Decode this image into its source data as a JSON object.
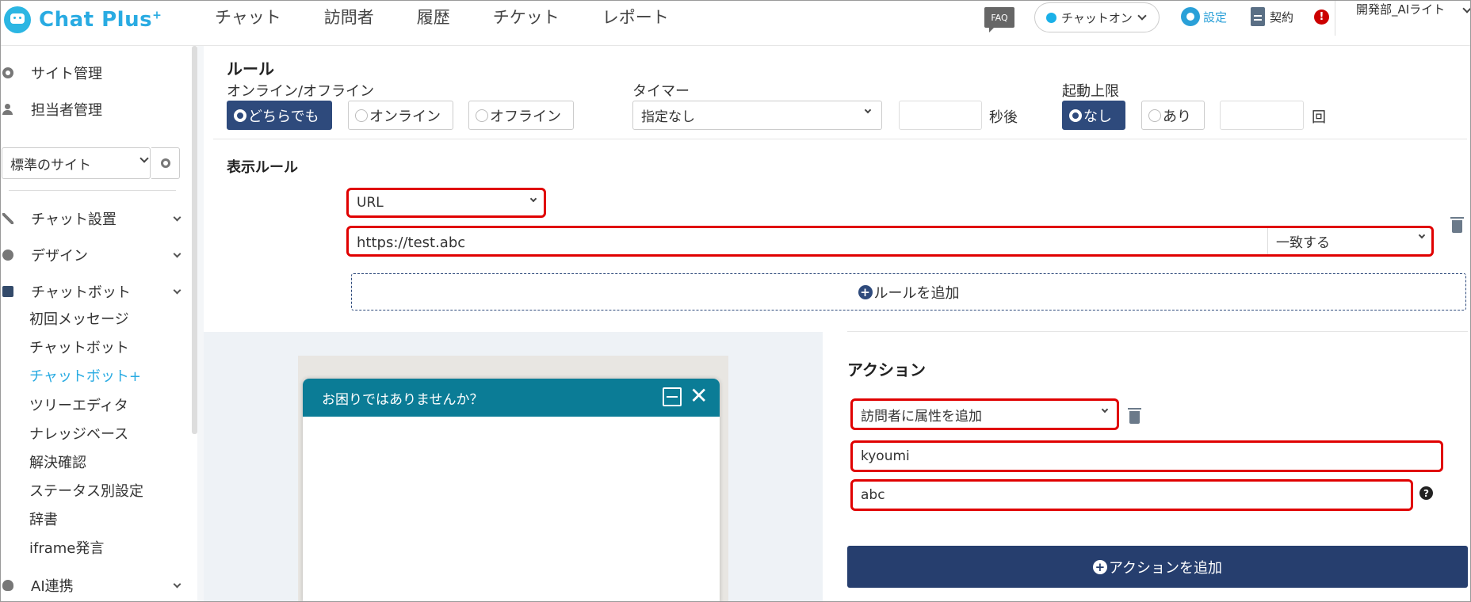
{
  "header": {
    "logo": "Chat Plus",
    "logo_sup": "+",
    "nav": [
      "チャット",
      "訪問者",
      "履歴",
      "チケット",
      "レポート"
    ],
    "faq": "FAQ",
    "chat_status": "チャットオン",
    "settings": "設定",
    "contract": "契約",
    "alert": "!",
    "user": "開発部_AIライト"
  },
  "sidebar": {
    "site_mgmt": "サイト管理",
    "staff_mgmt": "担当者管理",
    "site_select": "標準のサイト",
    "chat_setup": "チャット設置",
    "design": "デザイン",
    "chatbot": "チャットボット",
    "subitems": [
      "初回メッセージ",
      "チャットボット",
      "チャットボット+",
      "ツリーエディタ",
      "ナレッジベース",
      "解決確認",
      "ステータス別設定",
      "辞書",
      "iframe発言"
    ],
    "ai": "AI連携"
  },
  "rule": {
    "title": "ルール",
    "online_label": "オンライン/オフライン",
    "online_options": [
      "どちらでも",
      "オンライン",
      "オフライン"
    ],
    "timer_label": "タイマー",
    "timer_value": "指定なし",
    "seconds_after": "秒後",
    "limit_label": "起動上限",
    "limit_options": [
      "なし",
      "あり"
    ],
    "times": "回"
  },
  "display_rule": {
    "title": "表示ルール",
    "type": "URL",
    "url": "https://test.abc",
    "match": "一致する",
    "add_rule": "ルールを追加"
  },
  "preview": {
    "header": "お困りではありませんか？"
  },
  "action": {
    "title": "アクション",
    "type": "訪問者に属性を追加",
    "key": "kyoumi",
    "value": "abc",
    "add_action": "アクションを追加"
  }
}
